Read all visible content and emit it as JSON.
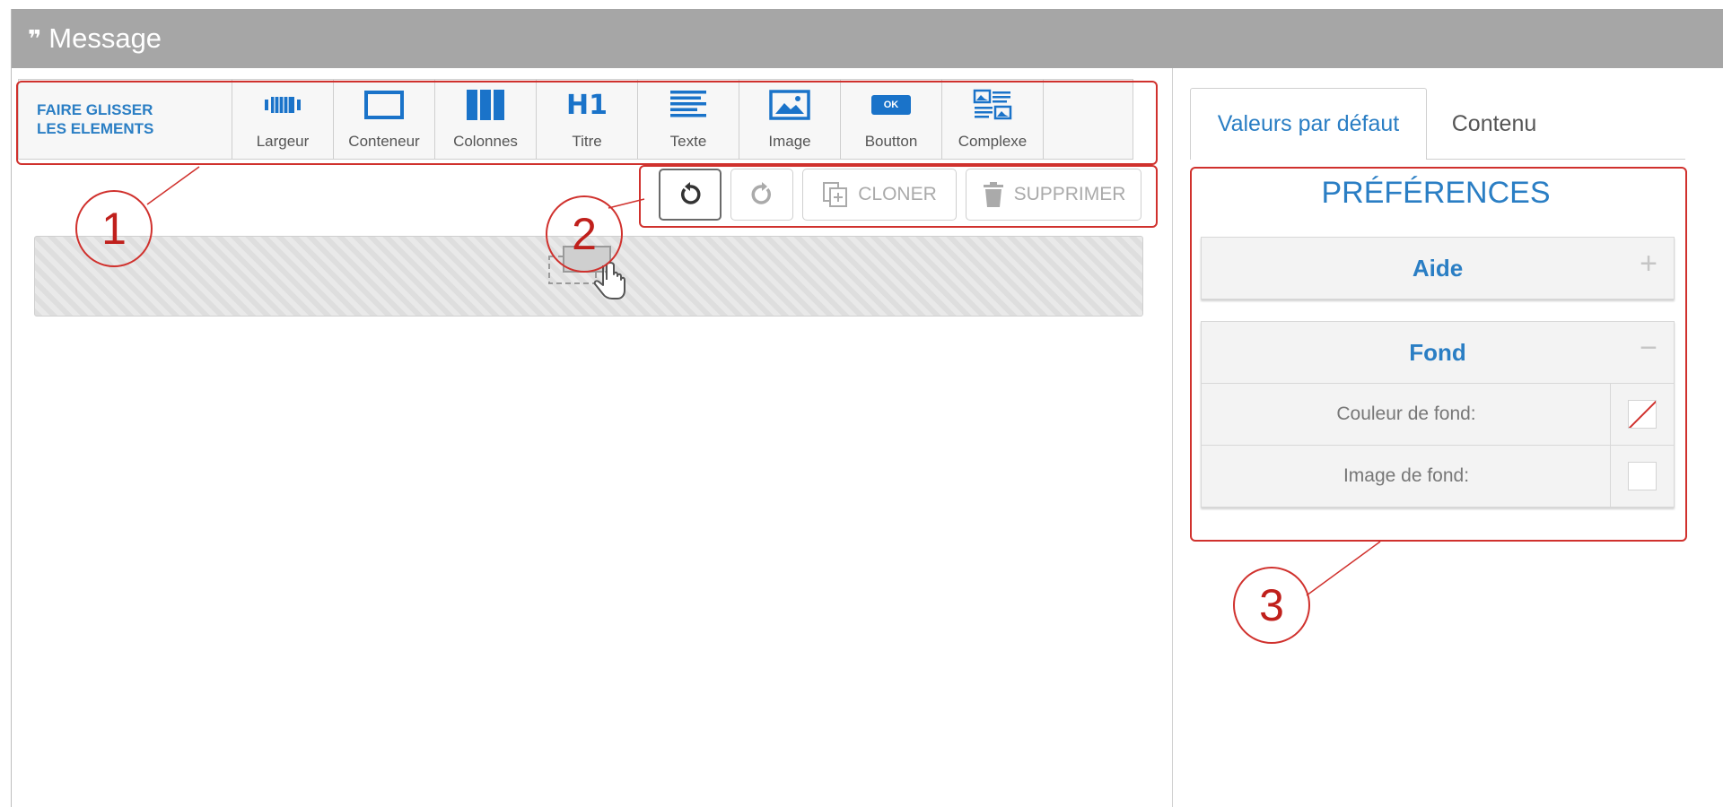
{
  "header": {
    "title": "Message",
    "icon": "quote-icon"
  },
  "toolbar": {
    "drag_label_line1": "FAIRE GLISSER",
    "drag_label_line2": "LES ELEMENTS",
    "tools": [
      {
        "label": "Largeur",
        "icon": "width-icon"
      },
      {
        "label": "Conteneur",
        "icon": "container-icon"
      },
      {
        "label": "Colonnes",
        "icon": "columns-icon"
      },
      {
        "label": "Titre",
        "icon": "heading-icon",
        "glyph": "H1"
      },
      {
        "label": "Texte",
        "icon": "text-icon"
      },
      {
        "label": "Image",
        "icon": "image-icon"
      },
      {
        "label": "Boutton",
        "icon": "button-icon",
        "glyph": "OK"
      },
      {
        "label": "Complexe",
        "icon": "complex-icon"
      }
    ]
  },
  "actions": {
    "undo_icon": "undo-icon",
    "redo_icon": "redo-icon",
    "clone_label": "CLONER",
    "delete_label": "SUPPRIMER"
  },
  "panel": {
    "tabs": [
      {
        "label": "Valeurs par défaut",
        "active": true
      },
      {
        "label": "Contenu",
        "active": false
      }
    ],
    "title": "PRÉFÉRENCES",
    "sections": {
      "aide": {
        "title": "Aide",
        "sign": "+"
      },
      "fond": {
        "title": "Fond",
        "sign": "−",
        "rows": [
          {
            "label": "Couleur de fond:"
          },
          {
            "label": "Image de fond:"
          }
        ]
      }
    }
  },
  "annotations": [
    "1",
    "2",
    "3"
  ],
  "colors": {
    "accent": "#2a7ec4",
    "annotation": "#d0312d",
    "header": "#a6a6a6"
  }
}
